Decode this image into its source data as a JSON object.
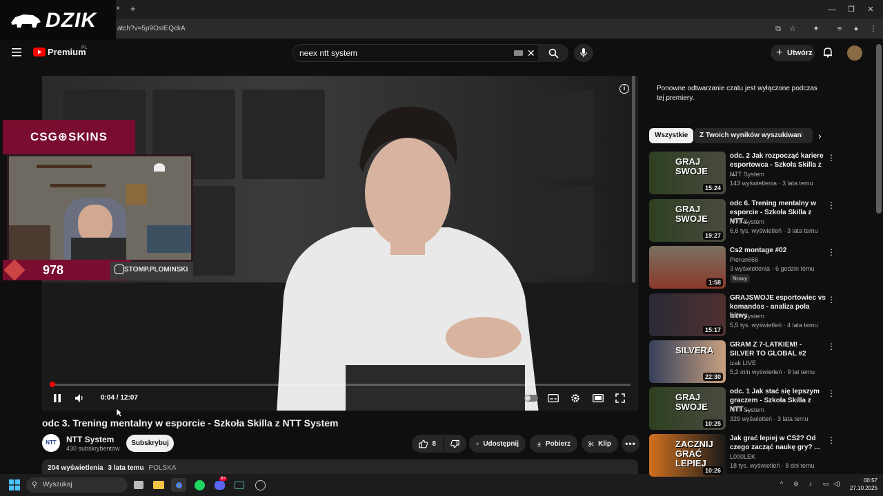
{
  "browser": {
    "url": "atch?v=5p9OsIEQckA",
    "new_tab": "+",
    "tab_close": "×"
  },
  "logo": {
    "dzik": "DZIK"
  },
  "header": {
    "brand": "Premium",
    "region": "PL",
    "search_value": "neex ntt system",
    "create_label": "Utwórz"
  },
  "overlay": {
    "csg": "CSG⊕SKINS",
    "score": "978",
    "insta": "STOMP.PLOMINSKI"
  },
  "player": {
    "time": "0:04 / 12:07",
    "progress_fraction": 0.005
  },
  "video": {
    "title": "odc 3. Trening mentalny w esporcie - Szkoła Skilla z NTT System",
    "channel": "NTT System",
    "channel_avatar": "NTT",
    "subs": "430 subskrybentów",
    "subscribe": "Subskrybuj",
    "likes": "8",
    "share": "Udostępnij",
    "download": "Pobierz",
    "clip": "Klip",
    "views": "204 wyświetlenia",
    "ago": "3 lata temu",
    "country": "POLSKA"
  },
  "sidebar": {
    "chat_message": "Ponowne odtwarzanie czatu jest wyłączone podczas tej premiery.",
    "chips": [
      "Wszystkie",
      "Z Twoich wyników wyszukiwania"
    ],
    "items": [
      {
        "title": "odc. 2  Jak rozpocząć kariere esportowca - Szkoła Skilla z ...",
        "channel": "NTT System",
        "meta": "143 wyświetlenia · 3 lata temu",
        "duration": "15:24",
        "thumb_text": "GRAJ SWOJE",
        "badge": ""
      },
      {
        "title": "odc 6. Trening mentalny w esporcie  - Szkoła Skilla z NTT...",
        "channel": "NTT System",
        "meta": "6,6 tys. wyświetleń · 3 lata temu",
        "duration": "19:27",
        "thumb_text": "GRAJ SWOJE",
        "badge": ""
      },
      {
        "title": "Cs2 montage #02",
        "channel": "Pierun666",
        "meta": "3 wyświetlenia · 6 godzin temu",
        "duration": "1:58",
        "thumb_text": "",
        "badge": "Nowy"
      },
      {
        "title": "GRAJSWOJE esportowiec vs komandos - analiza pola bitwy",
        "channel": "NTT System",
        "meta": "5,5 tys. wyświetleń · 4 lata temu",
        "duration": "15:17",
        "thumb_text": "",
        "badge": ""
      },
      {
        "title": "GRAM Z 7-LATKIEM! - SILVER TO GLOBAL #2",
        "channel": "izak LIVE",
        "meta": "5,2 mln wyświetleń · 9 lat temu",
        "duration": "22:30",
        "thumb_text": "SILVERA",
        "badge": ""
      },
      {
        "title": "odc. 1 Jak stać się lepszym graczem - Szkoła Skilla z NTT ...",
        "channel": "NTT System",
        "meta": "329 wyświetleń · 3 lata temu",
        "duration": "10:25",
        "thumb_text": "GRAJ SWOJE",
        "badge": ""
      },
      {
        "title": "Jak grać lepiej w CS2? Od czego zacząć naukę gry? ...",
        "channel": "L000LEK",
        "meta": "18 tys. wyświetleń · 8 dni temu",
        "duration": "10:26",
        "thumb_text": "ZACZNIJ GRAĆ LEPIEJ",
        "badge": ""
      }
    ]
  },
  "taskbar": {
    "search": "Wyszukaj",
    "time": "00:57",
    "date": "27.10.2025",
    "discord_badge": "9+"
  },
  "colors": {
    "accent": "#ff0000",
    "bg": "#0f0f0f",
    "overlay": "#7a0d2f"
  }
}
